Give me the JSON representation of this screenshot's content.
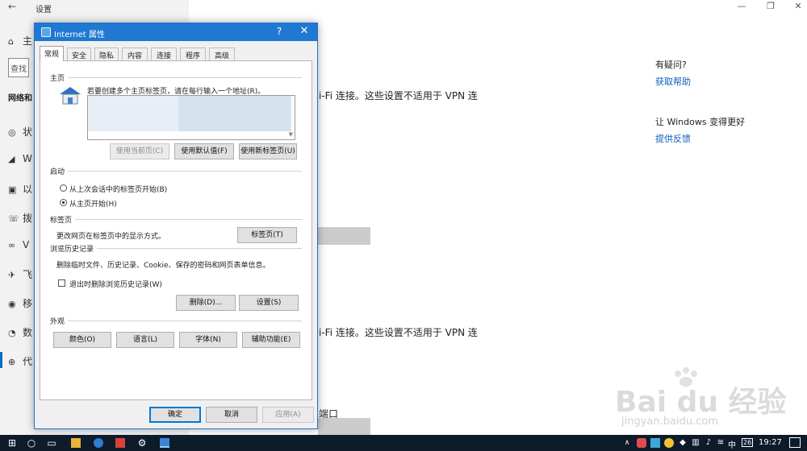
{
  "settings": {
    "title": "设置",
    "nav_home": "主",
    "search_placeholder": "查找",
    "section_head": "网络和",
    "nav_items": [
      "状",
      "W",
      "以",
      "拨",
      "V",
      "飞",
      "移",
      "数",
      "代"
    ],
    "main_text_1": "i-Fi 连接。这些设置不适用于 VPN 连",
    "main_text_2": "i-Fi 连接。这些设置不适用于 VPN 连",
    "main_text_3": "端口",
    "help_title": "有疑问?",
    "help_link": "获取帮助",
    "feedback_title": "让 Windows 变得更好",
    "feedback_link": "提供反馈"
  },
  "dialog": {
    "title": "Internet 属性",
    "help_glyph": "?",
    "close_glyph": "✕",
    "tabs": [
      "常规",
      "安全",
      "隐私",
      "内容",
      "连接",
      "程序",
      "高级"
    ],
    "homepage": {
      "label": "主页",
      "instruction": "若要创建多个主页标签页，请在每行输入一个地址(R)。",
      "buttons": [
        "使用当前页(C)",
        "使用默认值(F)",
        "使用新标签页(U)"
      ]
    },
    "startup": {
      "label": "启动",
      "options": [
        "从上次会话中的标签页开始(B)",
        "从主页开始(H)"
      ],
      "selected": "从主页开始(H)"
    },
    "tabs_group": {
      "label": "标签页",
      "text": "更改网页在标签页中的显示方式。",
      "button": "标签页(T)"
    },
    "history": {
      "label": "浏览历史记录",
      "text": "删除临时文件、历史记录、Cookie、保存的密码和网页表单信息。",
      "checkbox": "退出时删除浏览历史记录(W)",
      "buttons": [
        "删除(D)...",
        "设置(S)"
      ]
    },
    "appearance": {
      "label": "外观",
      "buttons": [
        "颜色(O)",
        "语言(L)",
        "字体(N)",
        "辅助功能(E)"
      ]
    },
    "footer": {
      "ok": "确定",
      "cancel": "取消",
      "apply": "应用(A)"
    }
  },
  "taskbar": {
    "ime": "中",
    "num_badge": "26",
    "clock": "19:27"
  },
  "watermark": {
    "text": "Bai du 经验",
    "sub": "jingyan.baidu.com"
  }
}
